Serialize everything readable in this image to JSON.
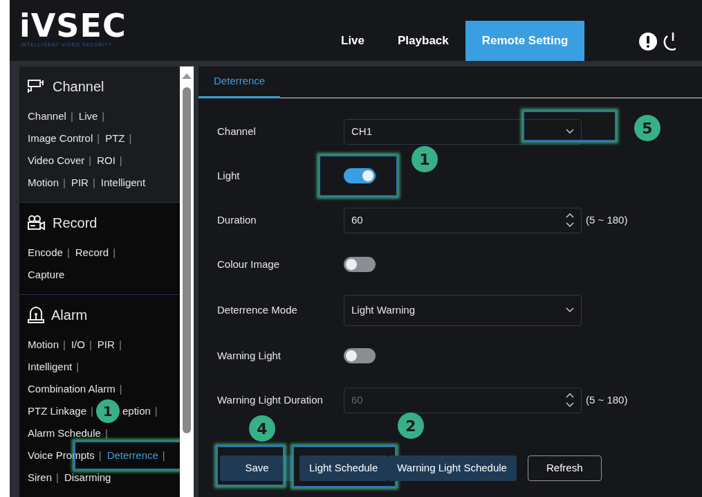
{
  "header": {
    "logo": "iVSEC",
    "tagline": "INTELLIGENT VIDEO SECURITY",
    "nav": [
      {
        "label": "Live",
        "selected": false
      },
      {
        "label": "Playback",
        "selected": false
      },
      {
        "label": "Remote Setting",
        "selected": true
      }
    ]
  },
  "sidebar": {
    "separator": "|",
    "sections": [
      {
        "title": "Channel",
        "rows": [
          [
            {
              "label": "Channel",
              "selected": false
            },
            {
              "label": "Live",
              "selected": false
            }
          ],
          [
            {
              "label": "Image Control",
              "selected": false
            },
            {
              "label": "PTZ",
              "selected": false
            }
          ],
          [
            {
              "label": "Video Cover",
              "selected": false
            },
            {
              "label": "ROI",
              "selected": false
            }
          ],
          [
            {
              "label": "Motion",
              "selected": false
            },
            {
              "label": "PIR",
              "selected": false
            },
            {
              "label": "Intelligent",
              "selected": false
            }
          ]
        ]
      },
      {
        "title": "Record",
        "rows": [
          [
            {
              "label": "Encode",
              "selected": false
            },
            {
              "label": "Record",
              "selected": false
            }
          ],
          [
            {
              "label": "Capture",
              "selected": false
            }
          ]
        ]
      },
      {
        "title": "Alarm",
        "rows": [
          [
            {
              "label": "Motion",
              "selected": false
            },
            {
              "label": "I/O",
              "selected": false
            },
            {
              "label": "PIR",
              "selected": false
            }
          ],
          [
            {
              "label": "Intelligent",
              "selected": false
            }
          ],
          [
            {
              "label": "Combination Alarm",
              "selected": false
            }
          ],
          [
            {
              "label": "PTZ Linkage",
              "selected": false
            },
            {
              "label": "eption",
              "selected": false
            }
          ],
          [
            {
              "label": "Alarm Schedule",
              "selected": false
            }
          ],
          [
            {
              "label": "Voice Prompts",
              "selected": false
            },
            {
              "label": "Deterrence",
              "selected": true,
              "highlight": true,
              "callout": "1"
            }
          ],
          [
            {
              "label": "Siren",
              "selected": false
            },
            {
              "label": "Disarming",
              "selected": false
            }
          ]
        ]
      }
    ]
  },
  "tabs": [
    {
      "label": "Deterrence",
      "selected": true
    }
  ],
  "fields": [
    {
      "kind": "select",
      "label": "Channel",
      "value": "CH1",
      "highlight": true,
      "callout": "5"
    },
    {
      "kind": "switch",
      "label": "Light",
      "on": true,
      "highlight": true,
      "callout": "1"
    },
    {
      "kind": "number",
      "label": "Duration",
      "value": "60",
      "range": "(5 ~ 180)",
      "disabled": false
    },
    {
      "kind": "switch",
      "label": "Colour Image",
      "on": false
    },
    {
      "kind": "select",
      "label": "Deterrence Mode",
      "value": "Light Warning"
    },
    {
      "kind": "switch",
      "label": "Warning Light",
      "on": false
    },
    {
      "kind": "number",
      "label": "Warning Light Duration",
      "value": "60",
      "range": "(5 ~ 180)",
      "disabled": true
    }
  ],
  "buttons": [
    {
      "label": "Save",
      "kind": "filled",
      "highlight": true,
      "callout": "4"
    },
    {
      "label": "Light Schedule",
      "kind": "filled",
      "highlight": true,
      "callout": "2"
    },
    {
      "label": "Warning Light Schedule",
      "kind": "filled"
    },
    {
      "label": "Refresh",
      "kind": "outline"
    }
  ]
}
